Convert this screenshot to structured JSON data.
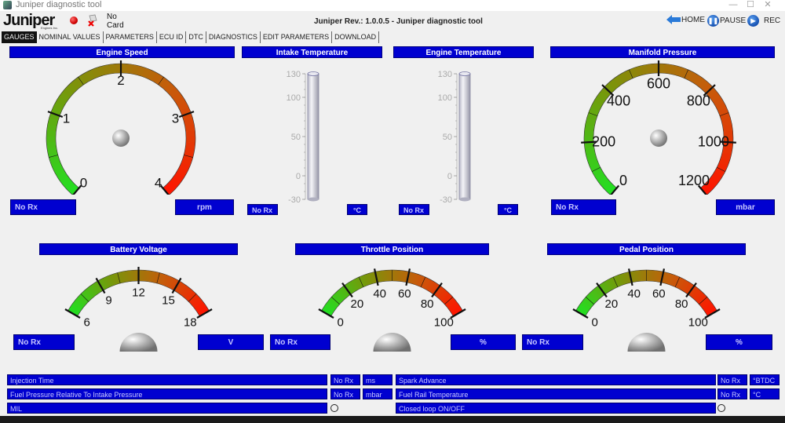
{
  "window": {
    "title": "Juniper diagnostic tool",
    "controls": [
      "—",
      "☐",
      "✕"
    ]
  },
  "header": {
    "logo": "Juniper",
    "logo_sub": "Engines Inc.",
    "card_status": [
      "No",
      "Card"
    ],
    "app_title": "Juniper Rev.: 1.0.0.5 - Juniper diagnostic tool",
    "home_label": "HOME",
    "pause_label": "PAUSE",
    "rec_label": "REC"
  },
  "tabs": [
    {
      "label": "GAUGES",
      "active": true
    },
    {
      "label": "NOMINAL VALUES",
      "active": false
    },
    {
      "label": "PARAMETERS",
      "active": false
    },
    {
      "label": "ECU ID",
      "active": false
    },
    {
      "label": "DTC",
      "active": false
    },
    {
      "label": "DIAGNOSTICS",
      "active": false
    },
    {
      "label": "EDIT PARAMETERS",
      "active": false
    },
    {
      "label": "DOWNLOAD",
      "active": false
    }
  ],
  "gauges": {
    "engine_speed": {
      "title": "Engine Speed",
      "value": "No Rx",
      "unit": "rpm",
      "ticks": [
        "0",
        "1",
        "2",
        "3",
        "4"
      ]
    },
    "intake_temperature": {
      "title": "Intake Temperature",
      "value": "No Rx",
      "unit": "°C",
      "ticks": [
        "130",
        "100",
        "50",
        "0",
        "-30"
      ]
    },
    "engine_temperature": {
      "title": "Engine Temperature",
      "value": "No Rx",
      "unit": "°C",
      "ticks": [
        "130",
        "100",
        "50",
        "0",
        "-30"
      ]
    },
    "manifold_pressure": {
      "title": "Manifold Pressure",
      "value": "No Rx",
      "unit": "mbar",
      "ticks": [
        "0",
        "200",
        "400",
        "600",
        "800",
        "1000",
        "1200"
      ]
    },
    "battery_voltage": {
      "title": "Battery Voltage",
      "value": "No Rx",
      "unit": "V",
      "ticks": [
        "6",
        "9",
        "12",
        "15",
        "18"
      ]
    },
    "throttle_position": {
      "title": "Throttle Position",
      "value": "No Rx",
      "unit": "%",
      "ticks": [
        "0",
        "20",
        "40",
        "60",
        "80",
        "100"
      ]
    },
    "pedal_position": {
      "title": "Pedal Position",
      "value": "No Rx",
      "unit": "%",
      "ticks": [
        "0",
        "20",
        "40",
        "60",
        "80",
        "100"
      ]
    }
  },
  "params_left": [
    {
      "label": "Injection Time",
      "value": "No Rx",
      "unit": "ms"
    },
    {
      "label": "Fuel Pressure Relative To Intake Pressure",
      "value": "No Rx",
      "unit": "mbar"
    },
    {
      "label": "MIL",
      "indicator": "off"
    }
  ],
  "params_right": [
    {
      "label": "Spark Advance",
      "value": "No Rx",
      "unit": "°BTDC"
    },
    {
      "label": "Fuel Rail Temperature",
      "value": "No Rx",
      "unit": "°C"
    },
    {
      "label": "Closed loop ON/OFF",
      "indicator": "off"
    }
  ],
  "colors": {
    "panel_blue": "#0000d0",
    "gauge_low": "#22e022",
    "gauge_high": "#ff1a00"
  }
}
